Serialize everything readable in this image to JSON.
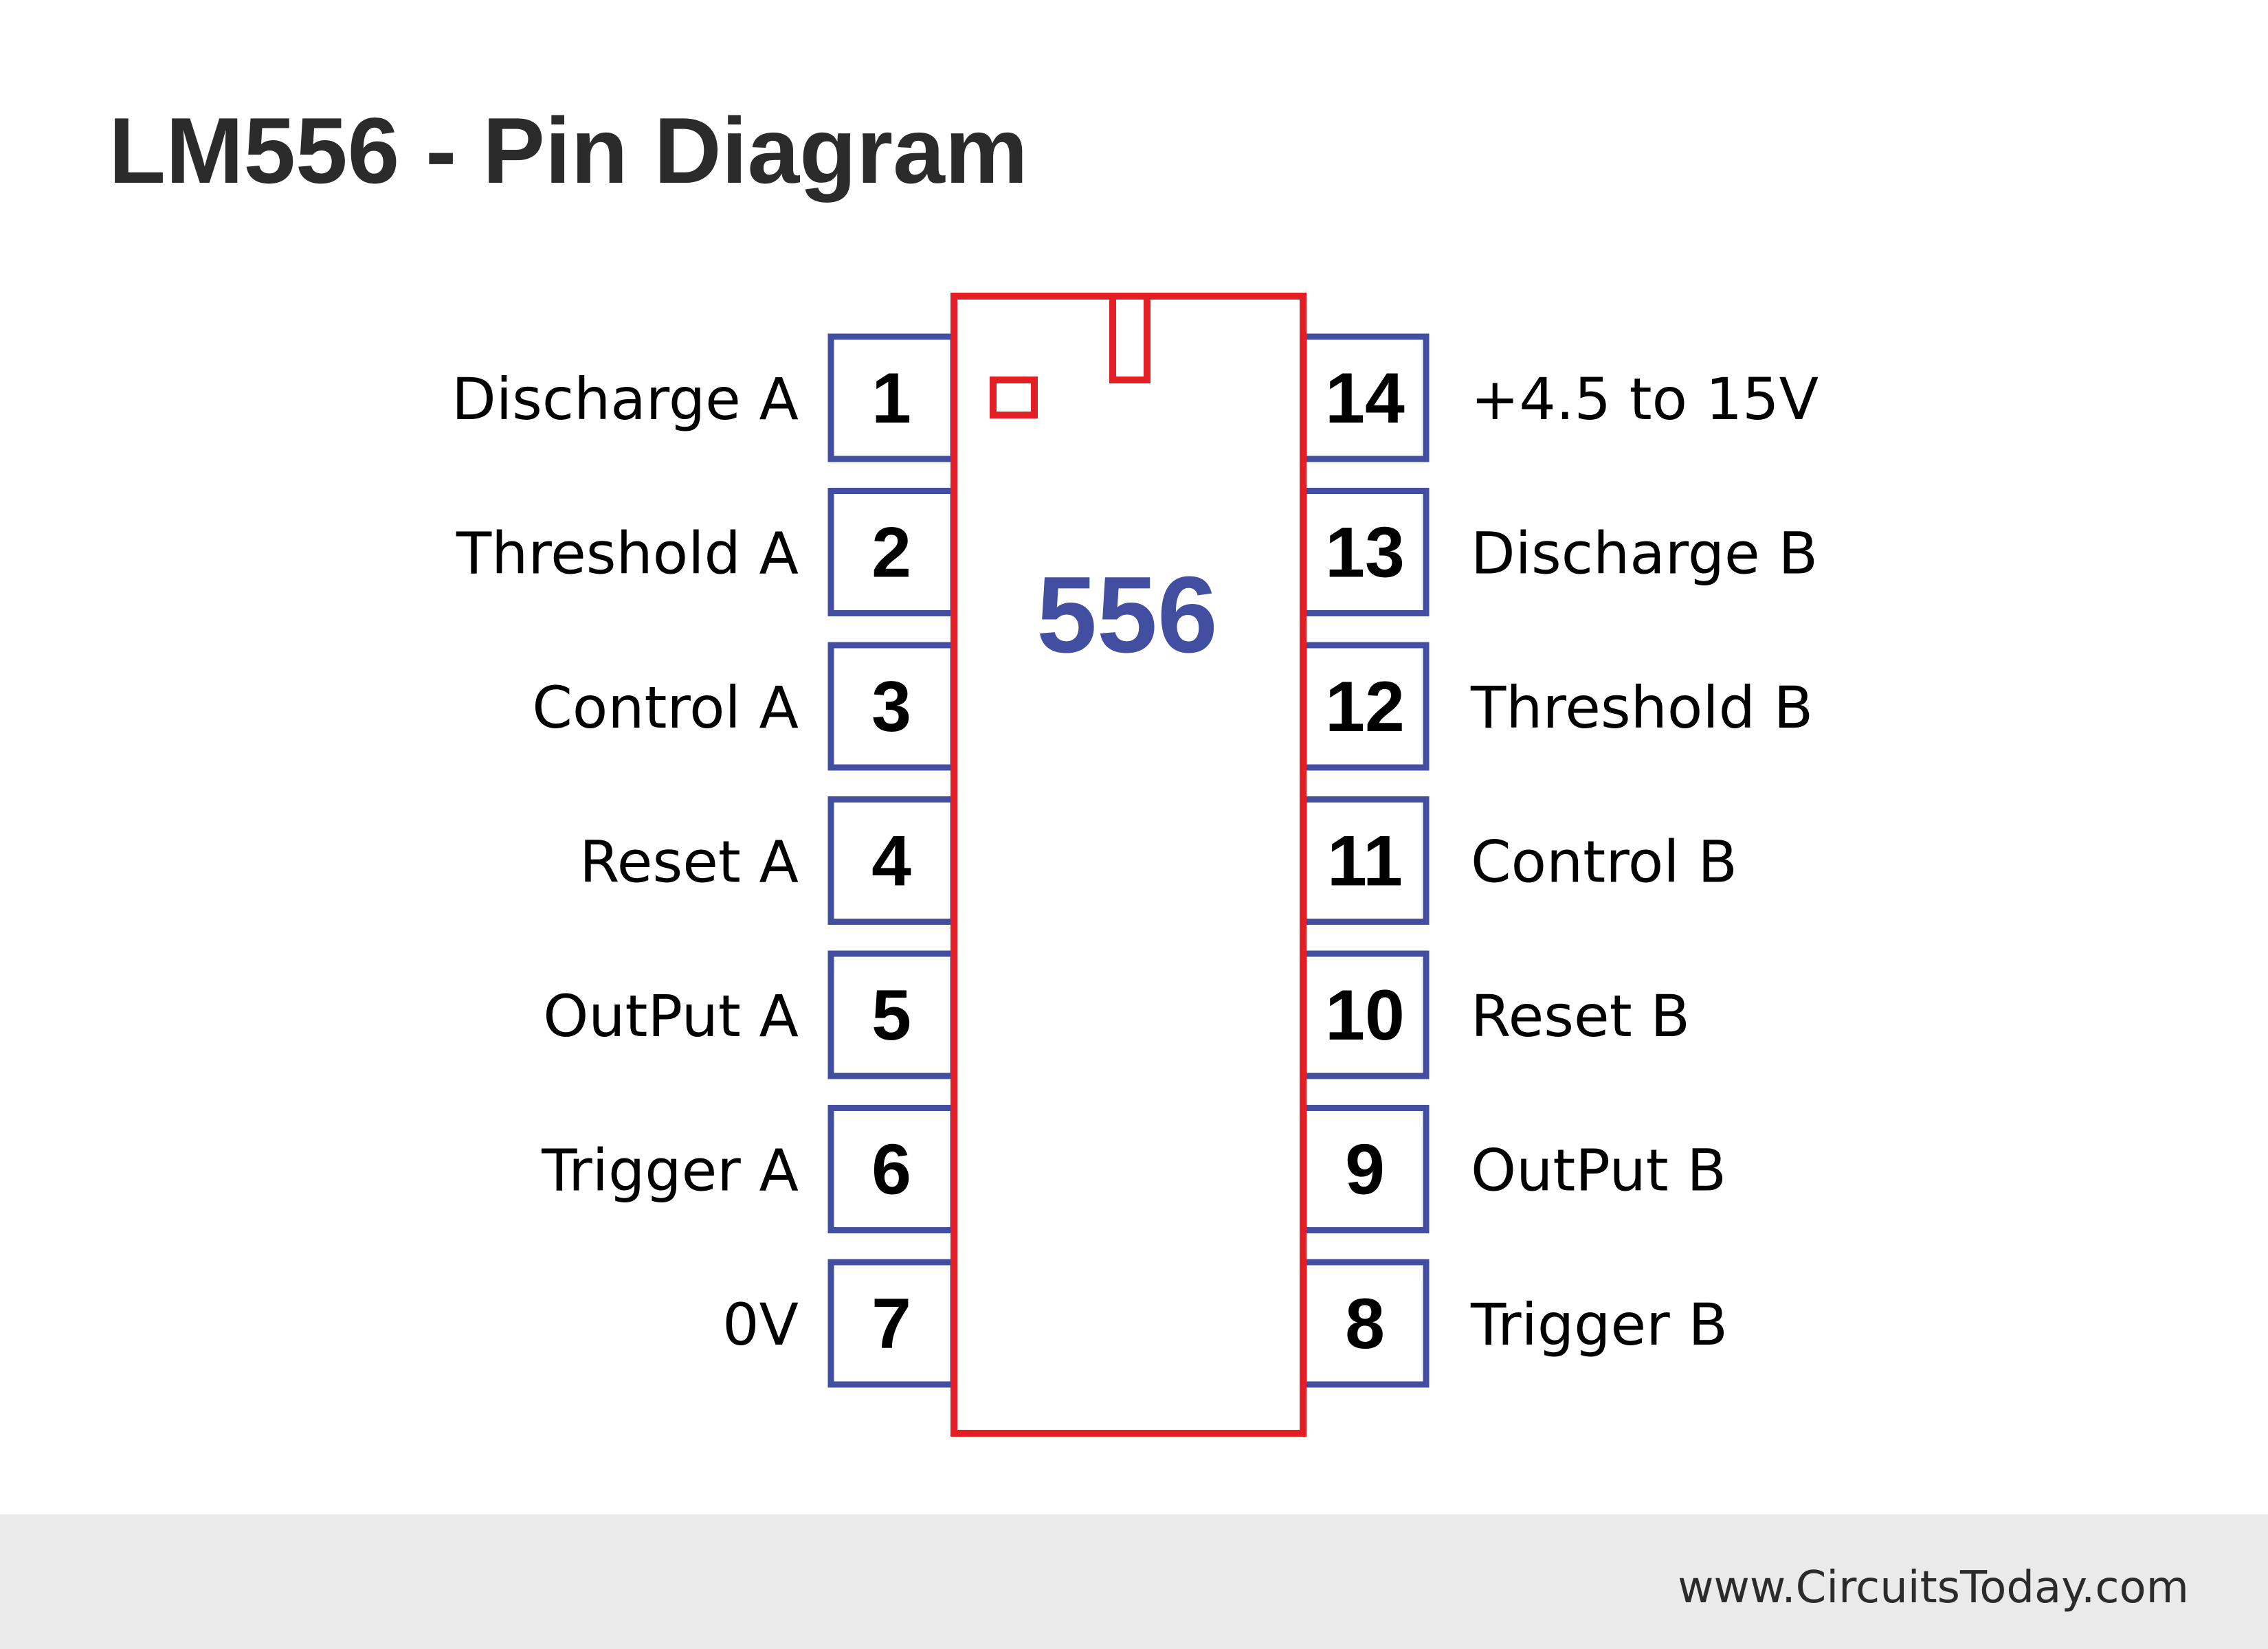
{
  "title": "LM556 - Pin Diagram",
  "chip": {
    "label": "556",
    "body_color": "#e31e25",
    "label_color": "#424fa0"
  },
  "pin_color": "#424fa0",
  "pins_left": [
    {
      "number": "1",
      "label": "Discharge A"
    },
    {
      "number": "2",
      "label": "Threshold A"
    },
    {
      "number": "3",
      "label": "Control A"
    },
    {
      "number": "4",
      "label": "Reset A"
    },
    {
      "number": "5",
      "label": "OutPut A"
    },
    {
      "number": "6",
      "label": "Trigger A"
    },
    {
      "number": "7",
      "label": "0V"
    }
  ],
  "pins_right": [
    {
      "number": "14",
      "label": "+4.5 to 15V"
    },
    {
      "number": "13",
      "label": "Discharge B"
    },
    {
      "number": "12",
      "label": "Threshold B"
    },
    {
      "number": "11",
      "label": "Control B"
    },
    {
      "number": "10",
      "label": "Reset B"
    },
    {
      "number": "9",
      "label": "OutPut B"
    },
    {
      "number": "8",
      "label": "Trigger B"
    }
  ],
  "footer": {
    "website": "www.CircuitsToday.com",
    "background": "#eaeaea"
  }
}
